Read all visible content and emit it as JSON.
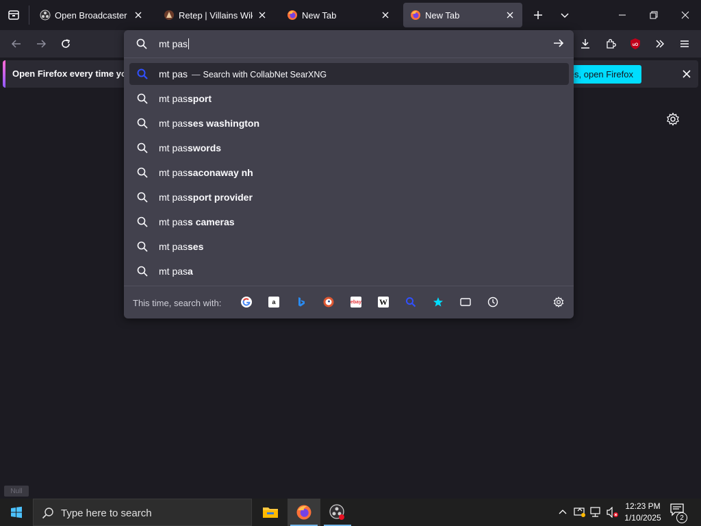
{
  "tabs": [
    {
      "title": "Open Broadcaster Software",
      "icon": "obs-icon"
    },
    {
      "title": "Retep | Villains Wiki | Fandom",
      "icon": "fandom-icon"
    },
    {
      "title": "New Tab",
      "icon": "firefox-icon"
    },
    {
      "title": "New Tab",
      "icon": "firefox-icon",
      "active": true
    }
  ],
  "notification": {
    "message": "Open Firefox every time you",
    "button": "es, open Firefox"
  },
  "urlbar": {
    "value": "mt pas",
    "heuristic": {
      "query": "mt pas",
      "separator": "—",
      "action": "Search with CollabNet SearXNG"
    },
    "suggestions": [
      {
        "prefix": "mt pas",
        "completion": "sport"
      },
      {
        "prefix": "mt pas",
        "completion": "ses washington"
      },
      {
        "prefix": "mt pas",
        "completion": "swords"
      },
      {
        "prefix": "mt pas",
        "completion": "saconaway nh"
      },
      {
        "prefix": "mt pas",
        "completion": "sport provider"
      },
      {
        "prefix": "mt pas",
        "completion": "s cameras"
      },
      {
        "prefix": "mt pas",
        "completion": "ses"
      },
      {
        "prefix": "mt pas",
        "completion": "a"
      }
    ],
    "footer_label": "This time, search with:",
    "engines": [
      "google",
      "amazon",
      "bing",
      "duckduckgo",
      "ebay",
      "wikipedia",
      "searxng",
      "bookmarks",
      "tabs",
      "history"
    ]
  },
  "tooltip": "Null",
  "taskbar": {
    "search_placeholder": "Type here to search",
    "time": "12:23 PM",
    "date": "1/10/2025",
    "notification_count": "2"
  },
  "colors": {
    "accent": "#00ddff",
    "background": "#1c1b22",
    "panel": "#42414d"
  }
}
